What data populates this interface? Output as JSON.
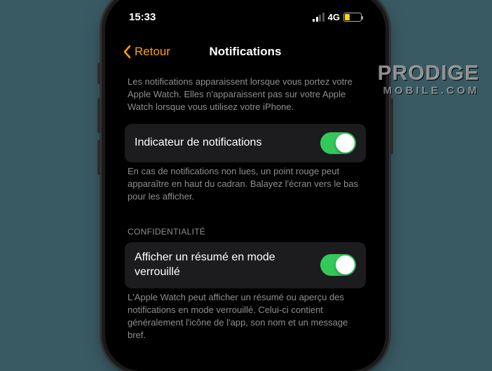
{
  "status": {
    "time": "15:33",
    "network": "4G",
    "battery_pct": "30"
  },
  "header": {
    "back": "Retour",
    "title": "Notifications"
  },
  "intro": "Les notifications apparaissent lorsque vous portez votre Apple Watch. Elles n'apparaissent pas sur votre Apple Watch lorsque vous utilisez votre iPhone.",
  "rows": {
    "indicator": {
      "label": "Indicateur de notifications",
      "desc": "En cas de notifications non lues, un point rouge peut apparaître en haut du cadran. Balayez l'écran vers le bas pour les afficher."
    },
    "privacy_section": "Confidentialité",
    "summary": {
      "label": "Afficher un résumé en mode verrouillé",
      "desc": "L'Apple Watch peut afficher un résumé ou aperçu des notifications en mode verrouillé. Celui-ci contient généralement l'icône de l'app, son nom et un message bref."
    }
  },
  "watermark": {
    "line1": "PRODIGE",
    "line2": "MOBILE.COM"
  }
}
